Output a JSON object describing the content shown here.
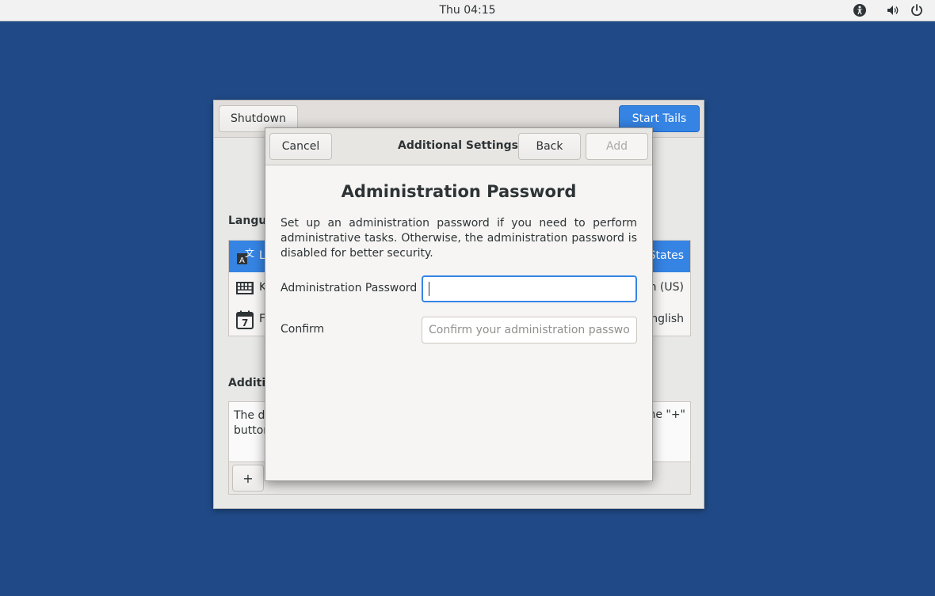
{
  "topbar": {
    "clock": "Thu 04:15",
    "icons": [
      "accessibility-icon",
      "volume-icon",
      "power-icon"
    ]
  },
  "greeter": {
    "shutdown_label": "Shutdown",
    "start_label": "Start Tails",
    "language_section_label": "Langua",
    "rows": [
      {
        "icon": "language-icon",
        "label": "L",
        "value": "States",
        "selected": true
      },
      {
        "icon": "keyboard-icon",
        "label": "K",
        "value": "h (US)",
        "selected": false
      },
      {
        "icon": "calendar-icon",
        "label": "F",
        "value": "nglish",
        "selected": false
      }
    ],
    "additional_section_label": "Additio",
    "additional_text_left": "The de\nbutton",
    "additional_text_right": "he \"+\"",
    "add_button_label": "+"
  },
  "dialog": {
    "cancel_label": "Cancel",
    "title": "Additional Settings",
    "back_label": "Back",
    "add_label": "Add",
    "heading": "Administration Password",
    "description": "Set up an administration password if you need to perform administrative tasks. Otherwise, the administration password is disabled for better security.",
    "password_label": "Administration Password",
    "password_value": "",
    "password_placeholder": "",
    "confirm_label": "Confirm",
    "confirm_value": "",
    "confirm_placeholder": "Confirm your administration passwo..."
  },
  "colors": {
    "desktop": "#204a87",
    "accent": "#3584e4"
  }
}
